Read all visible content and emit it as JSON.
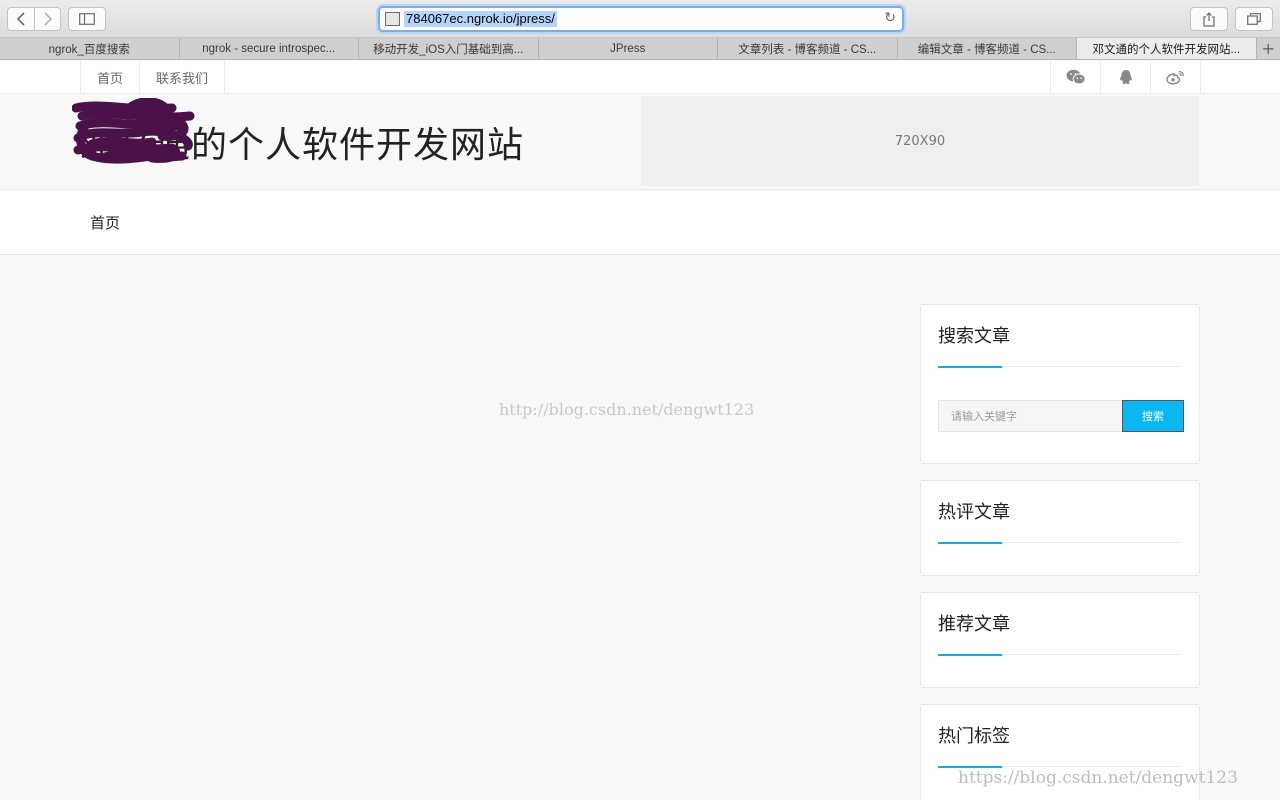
{
  "browser": {
    "url": "784067ec.ngrok.io/jpress/",
    "tabs": [
      {
        "label": "ngrok_百度搜索",
        "active": false
      },
      {
        "label": "ngrok - secure introspec...",
        "active": false
      },
      {
        "label": "移动开发_iOS入门基础到高...",
        "active": false
      },
      {
        "label": "JPress",
        "active": false
      },
      {
        "label": "文章列表 - 博客频道 - CS...",
        "active": false
      },
      {
        "label": "编辑文章 - 博客频道 - CS...",
        "active": false
      },
      {
        "label": "邓文通的个人软件开发网站...",
        "active": true
      }
    ],
    "new_tab": "+"
  },
  "topnav": {
    "links": [
      "首页",
      "联系我们"
    ],
    "social_icons": [
      "wechat-icon",
      "qq-icon",
      "weibo-icon"
    ]
  },
  "header": {
    "site_title": "邓文通的个人软件开发网站",
    "ad_label": "720X90"
  },
  "mainnav": {
    "home": "首页"
  },
  "watermarks": {
    "center": "http://blog.csdn.net/dengwt123",
    "corner": "https://blog.csdn.net/dengwt123"
  },
  "sidebar": {
    "search": {
      "title": "搜索文章",
      "placeholder": "请输入关键字",
      "button": "搜索"
    },
    "hot_comments": {
      "title": "热评文章"
    },
    "recommended": {
      "title": "推荐文章"
    },
    "hot_tags": {
      "title": "热门标签"
    }
  },
  "colors": {
    "accent": "#0ab2ec",
    "scribble": "#4a1248"
  }
}
